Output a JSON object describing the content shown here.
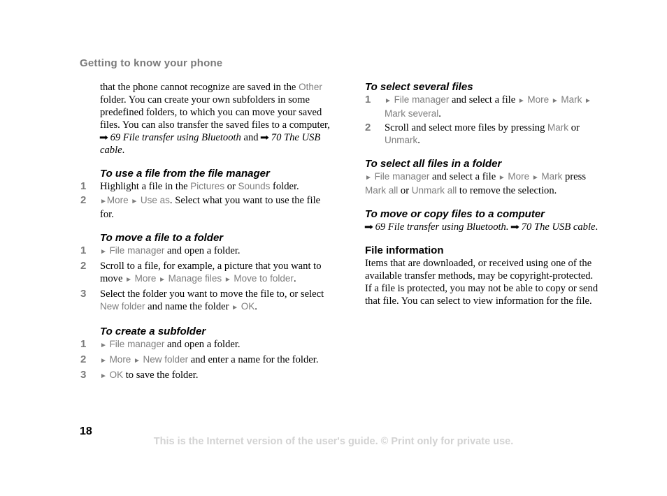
{
  "header": {
    "title": "Getting to know your phone"
  },
  "page_number": "18",
  "footer": {
    "notice": "This is the Internet version of the user's guide. © Print only for private use."
  },
  "icons": {
    "menu_arrow": "triangle-right-icon",
    "ref_arrow": "arrow-right-icon"
  },
  "colors": {
    "menu_text": "#7d7d7d",
    "header": "#7a7a7a",
    "footer": "#d2d2d2"
  },
  "left": {
    "intro": {
      "t1": "that the phone cannot recognize are saved in the",
      "other": "Other",
      "t2": " folder. You can create your own subfolders in some predefined folders, to which you can move your saved files. You can also transfer the saved files to a computer, ",
      "ref1": "69 File transfer using Bluetooth",
      "t3": " and ",
      "ref2": "70 The USB cable",
      "t4": "."
    },
    "use_file": {
      "title": "To use a file from the file manager",
      "s1": {
        "n": "1",
        "a": "Highlight a file in the ",
        "b": "Pictures",
        "c": " or ",
        "d": "Sounds",
        "e": " folder."
      },
      "s2": {
        "n": "2",
        "m1": "More",
        "m2": "Use as",
        "e": ". Select what you want to use the file for."
      }
    },
    "move_file": {
      "title": "To move a file to a folder",
      "s1": {
        "n": "1",
        "m1": "File manager",
        "e": " and open a folder."
      },
      "s2": {
        "n": "2",
        "a": "Scroll to a file, for example, a picture that you want to move ",
        "m1": "More",
        "m2": "Manage files",
        "m3": "Move to folder",
        "e": "."
      },
      "s3": {
        "n": "3",
        "a": "Select the folder you want to move the file to, or select ",
        "m1": "New folder",
        "b": " and name the folder ",
        "m2": "OK",
        "e": "."
      }
    },
    "subfolder": {
      "title": "To create a subfolder",
      "s1": {
        "n": "1",
        "m1": "File manager",
        "e": " and open a folder."
      },
      "s2": {
        "n": "2",
        "m1": "More",
        "m2": "New folder",
        "e": " and enter a name for the folder."
      },
      "s3": {
        "n": "3",
        "m1": "OK",
        "e": " to save the folder."
      }
    }
  },
  "right": {
    "several": {
      "title": "To select several files",
      "s1": {
        "n": "1",
        "m1": "File manager",
        "a": " and select a file ",
        "m2": "More",
        "m3": "Mark",
        "m4": "Mark several",
        "e": "."
      },
      "s2": {
        "n": "2",
        "a": "Scroll and select more files by pressing ",
        "m1": "Mark",
        "b": " or ",
        "m2": "Unmark",
        "e": "."
      }
    },
    "all": {
      "title": "To select all files in a folder",
      "m1": "File manager",
      "a": " and select a file ",
      "m2": "More",
      "m3": "Mark",
      "b": " press ",
      "m4": "Mark all",
      "c": " or ",
      "m5": "Unmark all",
      "e": " to remove the selection."
    },
    "copy": {
      "title": "To move or copy files to a computer",
      "ref1": "69 File transfer using Bluetooth.",
      "ref2": "70 The USB cable",
      "e": "."
    },
    "info": {
      "title": "File information",
      "body": "Items that are downloaded, or received using one of the available transfer methods, may be copyright-protected. If a file is protected, you may not be able to copy or send that file. You can select to view information for the file."
    }
  }
}
